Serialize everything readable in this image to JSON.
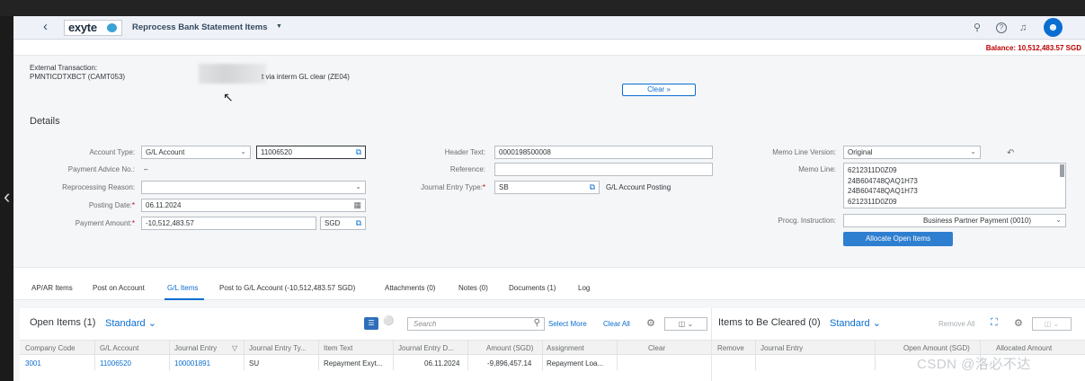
{
  "shell": {
    "app_title": "Reprocess Bank Statement Items",
    "logo_text": "exyte",
    "balance": "Balance: 10,512,483.57 SGD"
  },
  "header": {
    "external_transaction_label": "External Transaction:",
    "external_transaction_value": "PMNTICDTXBCT (CAMT053)",
    "description": "t via interm GL clear (ZE04)"
  },
  "details": {
    "title": "Details",
    "account_type": {
      "label": "Account Type:",
      "value": "G/L Account",
      "account": "11006520"
    },
    "payment_advice": {
      "label": "Payment Advice No.:",
      "value": "–"
    },
    "reprocessing_reason": {
      "label": "Reprocessing Reason:",
      "value": ""
    },
    "posting_date": {
      "label": "Posting Date:",
      "value": "06.11.2024"
    },
    "payment_amount": {
      "label": "Payment Amount:",
      "value": "-10,512,483.57",
      "currency": "SGD"
    },
    "header_text": {
      "label": "Header Text:",
      "value": "0000198500008"
    },
    "reference": {
      "label": "Reference:",
      "value": ""
    },
    "journal_entry_type": {
      "label": "Journal Entry Type:",
      "value": "SB",
      "description": "G/L Account Posting"
    },
    "memo_line_version": {
      "label": "Memo Line Version:",
      "value": "Original"
    },
    "memo_line": {
      "label": "Memo Line:",
      "lines": [
        "6212311D0Z09",
        "24B604748QAQ1H73",
        "24B604748QAQ1H73",
        "6212311D0Z09"
      ]
    },
    "procg_instruction": {
      "label": "Procg. Instruction:",
      "value": "Business Partner Payment (0010)"
    },
    "allocate_button": "Allocate Open Items"
  },
  "tabs": [
    "AP/AR Items",
    "Post on Account",
    "G/L Items",
    "Post to G/L Account (-10,512,483.57 SGD)",
    "Attachments (0)",
    "Notes (0)",
    "Documents (1)",
    "Log"
  ],
  "active_tab": "G/L Items",
  "open_items": {
    "title": "Open Items (1)",
    "variant": "Standard",
    "search_placeholder": "Search",
    "select_more": "Select More",
    "clear_all": "Clear All",
    "columns": [
      "Company Code",
      "G/L Account",
      "Journal Entry",
      "Journal Entry Ty...",
      "Item Text",
      "Journal Entry D...",
      "Amount (SGD)",
      "Assignment",
      "Clear"
    ],
    "rows": [
      {
        "company_code": "3001",
        "gl_account": "11006520",
        "journal_entry": "100001891",
        "je_type": "SU",
        "item_text": "Repayment Exyt...",
        "je_date": "06.11.2024",
        "amount": "-9,896,457.14",
        "assignment": "Repayment Loa...",
        "clear": "Clear"
      }
    ]
  },
  "items_to_clear": {
    "title": "Items to Be Cleared (0)",
    "variant": "Standard",
    "remove_all": "Remove All",
    "columns": [
      "Remove",
      "Journal Entry",
      "Open Amount (SGD)",
      "Allocated Amount"
    ]
  },
  "watermark": "CSDN @洛必不达",
  "colors": {
    "accent": "#0a6ed1",
    "balance": "#bb0000",
    "shell": "#eef1f7"
  },
  "icons": [
    "back-icon",
    "search-icon",
    "help-icon",
    "bell-icon",
    "avatar-icon",
    "value-help-icon",
    "calendar-icon",
    "undo-icon",
    "list-view-icon",
    "globe-icon",
    "settings-icon",
    "export-icon",
    "fullscreen-icon"
  ]
}
